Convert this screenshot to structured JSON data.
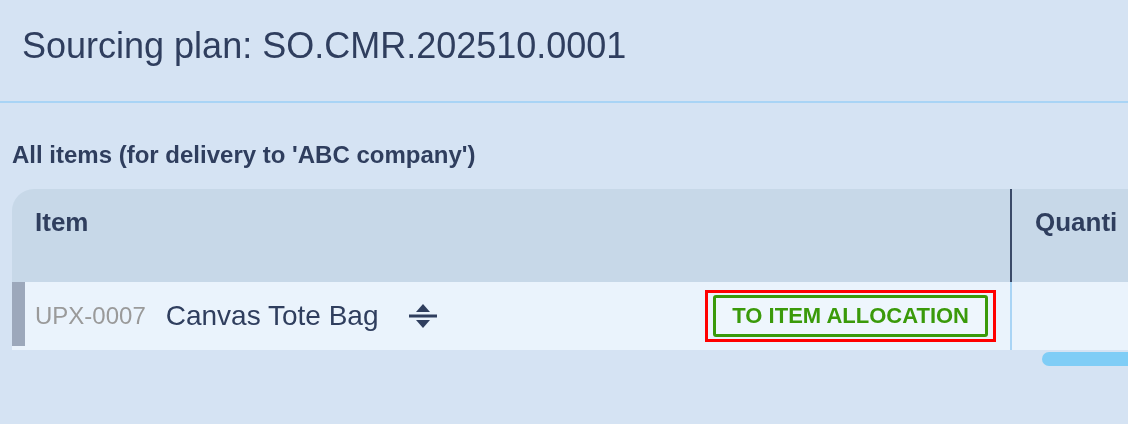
{
  "title": "Sourcing plan: SO.CMR.202510.0001",
  "section_title": "All items (for delivery to 'ABC company')",
  "table": {
    "columns": [
      "Item",
      "Quanti"
    ],
    "rows": [
      {
        "code": "UPX-0007",
        "name": "Canvas Tote Bag",
        "action": "TO ITEM ALLOCATION",
        "highlighted": true
      }
    ]
  }
}
